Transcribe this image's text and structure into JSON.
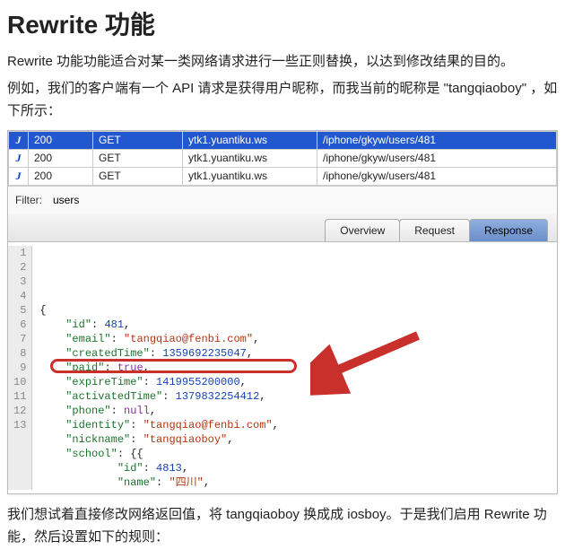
{
  "heading": "Rewrite 功能",
  "intro": [
    "Rewrite 功能功能适合对某一类网络请求进行一些正则替换，以达到修改结果的目的。",
    "例如，我们的客户端有一个 API 请求是获得用户昵称，而我当前的昵称是 \"tangqiaoboy\" ，如下所示："
  ],
  "requests": [
    {
      "glyph": "J",
      "code": "200",
      "method": "GET",
      "host": "ytk1.yuantiku.ws",
      "path": "/iphone/gkyw/users/481",
      "selected": true
    },
    {
      "glyph": "J",
      "code": "200",
      "method": "GET",
      "host": "ytk1.yuantiku.ws",
      "path": "/iphone/gkyw/users/481",
      "selected": false
    },
    {
      "glyph": "J",
      "code": "200",
      "method": "GET",
      "host": "ytk1.yuantiku.ws",
      "path": "/iphone/gkyw/users/481",
      "selected": false
    }
  ],
  "filter": {
    "label": "Filter:",
    "value": "users"
  },
  "tabs": {
    "overview": "Overview",
    "request": "Request",
    "response": "Response"
  },
  "json_lines": [
    "{",
    "    \"id\": 481,",
    "    \"email\": \"tangqiao@fenbi.com\",",
    "    \"createdTime\": 1359692235047,",
    "    \"paid\": true,",
    "    \"expireTime\": 1419955200000,",
    "    \"activatedTime\": 1379832254412,",
    "    \"phone\": null,",
    "    \"identity\": \"tangqiao@fenbi.com\",",
    "    \"nickname\": \"tangqiaoboy\",",
    "    \"school\": {{",
    "            \"id\": 4813,",
    "            \"name\": \"四川\","
  ],
  "outro": "我们想试着直接修改网络返回值，将 tangqiaoboy 换成成 iosboy。于是我们启用 Rewrite 功能，然后设置如下的规则："
}
